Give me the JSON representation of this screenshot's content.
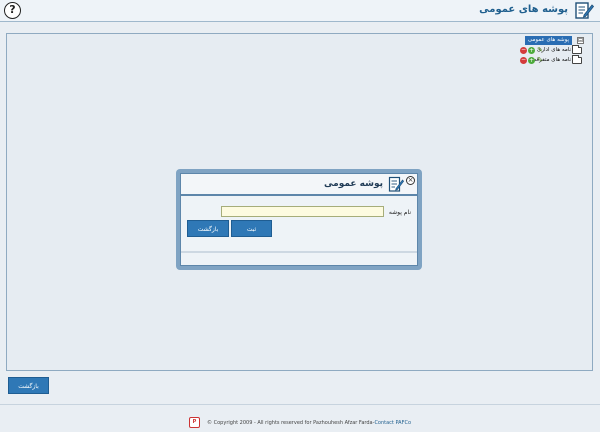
{
  "header": {
    "title": "پوشه های عمومی",
    "help_glyph": "?",
    "help_icon": "question-circle-icon",
    "title_icon": "edit-document-icon"
  },
  "tree": {
    "root_label": "پوشه های عمومی",
    "expander": "⊟",
    "items": [
      {
        "label": "نامه های اداری"
      },
      {
        "label": "نامه های متفرقه"
      }
    ]
  },
  "dialog": {
    "title": "پوشه عمومی",
    "close_glyph": "×",
    "field_label": "نام پوشه",
    "name_value": "",
    "submit_label": "ثبت",
    "back_label": "بازگشت"
  },
  "main": {
    "back_label": "بازگشت"
  },
  "footer": {
    "logo_text": "P",
    "copyright": "© Copyright 2009 - All rights reserved for Pazhouhesh Afzar Farda",
    "separator": " -",
    "contact_label": "Contact PAFCo"
  },
  "colors": {
    "accent": "#2f78b6",
    "header_title": "#1f5f8e",
    "dialog_frame": "#7fa3c3",
    "input_bg": "#fdfbe0"
  }
}
